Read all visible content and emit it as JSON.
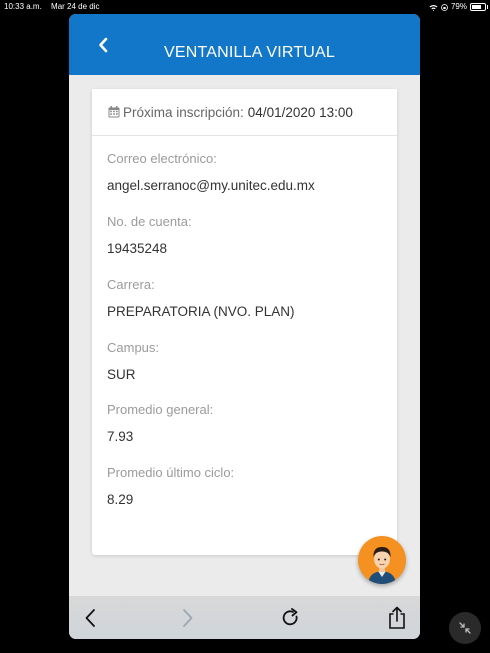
{
  "status_bar": {
    "time": "10:33 a.m.",
    "date": "Mar 24 de dic",
    "battery": "79%"
  },
  "header": {
    "title": "VENTANILLA VIRTUAL"
  },
  "next_registration": {
    "label": "Próxima inscripción:",
    "value": "04/01/2020 13:00"
  },
  "fields": [
    {
      "label": "Correo electrónico:",
      "value": "angel.serranoc@my.unitec.edu.mx"
    },
    {
      "label": "No. de cuenta:",
      "value": "19435248"
    },
    {
      "label": "Carrera:",
      "value": "PREPARATORIA (NVO. PLAN)"
    },
    {
      "label": "Campus:",
      "value": "SUR"
    },
    {
      "label": "Promedio general:",
      "value": "7.93"
    },
    {
      "label": "Promedio último ciclo:",
      "value": "8.29"
    }
  ],
  "icons": {
    "back": "chevron-left-icon",
    "calendar": "calendar-icon",
    "nav_back": "chevron-left-icon",
    "nav_forward": "chevron-right-icon",
    "reload": "reload-icon",
    "share": "share-icon",
    "collapse": "collapse-icon"
  },
  "colors": {
    "header": "#1277c8",
    "avatar_bg": "#f59120"
  }
}
